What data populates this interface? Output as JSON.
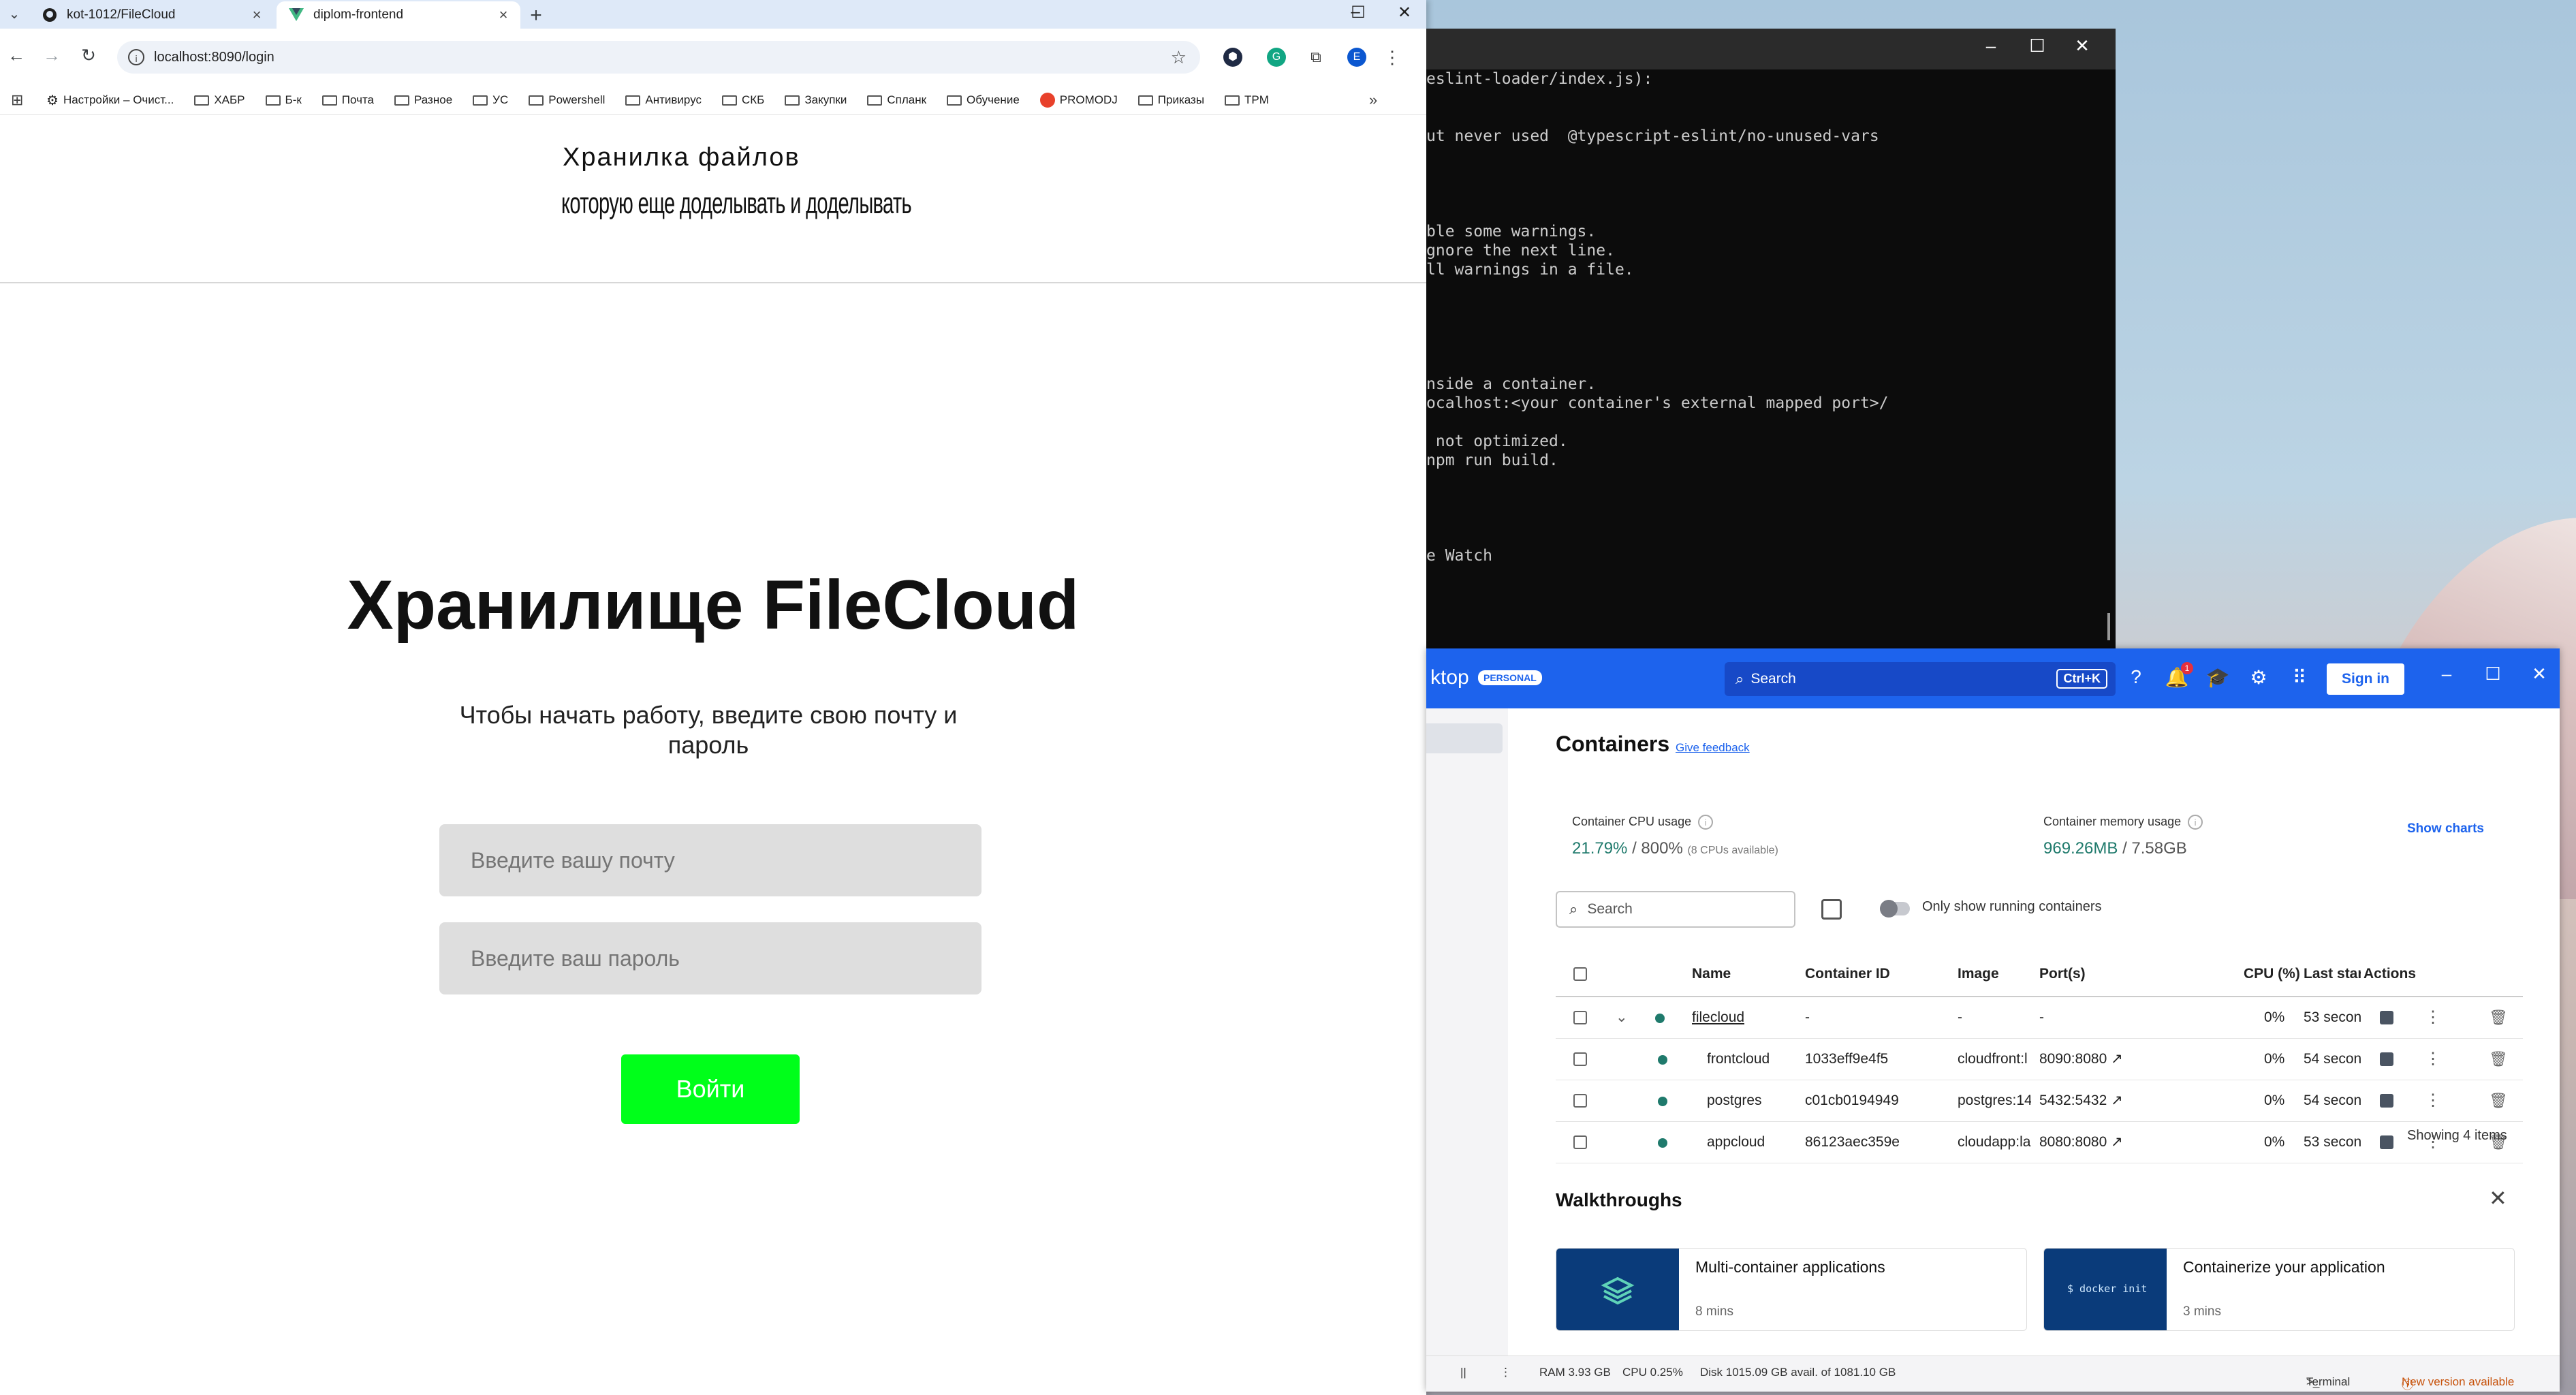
{
  "browser": {
    "tabs": [
      {
        "title": "kot-1012/FileCloud",
        "active": false,
        "icon": "github-icon"
      },
      {
        "title": "diplom-frontend",
        "active": true,
        "icon": "vue-icon"
      }
    ],
    "url": "localhost:8090/login",
    "bookmarks": [
      {
        "label": "Настройки – Очист...",
        "icon": "gear-icon"
      },
      {
        "label": "ХАБР",
        "icon": "folder-icon"
      },
      {
        "label": "Б-к",
        "icon": "folder-icon"
      },
      {
        "label": "Почта",
        "icon": "folder-icon"
      },
      {
        "label": "Разное",
        "icon": "folder-icon"
      },
      {
        "label": "УС",
        "icon": "folder-icon"
      },
      {
        "label": "Powershell",
        "icon": "folder-icon"
      },
      {
        "label": "Антивирус",
        "icon": "folder-icon"
      },
      {
        "label": "СКБ",
        "icon": "folder-icon"
      },
      {
        "label": "Закупки",
        "icon": "folder-icon"
      },
      {
        "label": "Спланк",
        "icon": "folder-icon"
      },
      {
        "label": "Обучение",
        "icon": "folder-icon"
      },
      {
        "label": "PROMODJ",
        "icon": "promodj-icon"
      },
      {
        "label": "Приказы",
        "icon": "folder-icon"
      },
      {
        "label": "TPM",
        "icon": "folder-icon"
      }
    ],
    "profile_initial": "E"
  },
  "site": {
    "header_title": "Хранилка файлов",
    "header_subtitle": "которую еще доделывать и доделывать",
    "login_title": "Хранилище FileCloud",
    "login_subtitle": "Чтобы начать работу, введите свою почту и пароль",
    "email_placeholder": "Введите вашу почту",
    "password_placeholder": "Введите ваш пароль",
    "login_button": "Войти"
  },
  "terminal": {
    "lines": [
      "eslint-loader/index.js):",
      "",
      "",
      "ut never used  @typescript-eslint/no-unused-vars",
      "",
      "",
      "",
      "",
      "ble some warnings.",
      "gnore the next line.",
      "ll warnings in a file.",
      "",
      "",
      "",
      "",
      "",
      "nside a container.",
      "ocalhost:<your container's external mapped port>/",
      "",
      " not optimized.",
      "npm run build.",
      "",
      "",
      "",
      "",
      "e Watch"
    ]
  },
  "docker": {
    "brand": "ktop",
    "badge": "PERSONAL",
    "search_label": "Search",
    "search_shortcut": "Ctrl+K",
    "notif_count": "1",
    "sign_in": "Sign in",
    "containers_title": "Containers",
    "give_feedback": "Give feedback",
    "cpu_label": "Container CPU usage",
    "cpu_value": "21.79%",
    "cpu_total": " / 800%",
    "cpu_note": "(8 CPUs available)",
    "mem_label": "Container memory usage",
    "mem_value": "969.26MB",
    "mem_total": " / 7.58GB",
    "show_charts": "Show charts",
    "search_placeholder": "Search",
    "only_running": "Only show running containers",
    "columns": [
      "Name",
      "Container ID",
      "Image",
      "Port(s)",
      "CPU (%)",
      "Last star",
      "Actions"
    ],
    "rows": [
      {
        "name": "filecloud",
        "id": "-",
        "image": "-",
        "ports": "-",
        "cpu": "0%",
        "last": "53 secon",
        "group": true
      },
      {
        "name": "frontcloud",
        "id": "1033eff9e4f5",
        "image": "cloudfront:l",
        "ports": "8090:8080",
        "cpu": "0%",
        "last": "54 secon",
        "group": false
      },
      {
        "name": "postgres",
        "id": "c01cb0194949",
        "image": "postgres:14",
        "ports": "5432:5432",
        "cpu": "0%",
        "last": "54 secon",
        "group": false
      },
      {
        "name": "appcloud",
        "id": "86123aec359e",
        "image": "cloudapp:la",
        "ports": "8080:8080",
        "cpu": "0%",
        "last": "53 secon",
        "group": false
      }
    ],
    "showing": "Showing 4 items",
    "walkthroughs_title": "Walkthroughs",
    "cards": [
      {
        "title": "Multi-container applications",
        "meta": "8 mins"
      },
      {
        "title": "Containerize your application",
        "meta": "3 mins",
        "thumb_text": "$ docker init"
      }
    ],
    "status": {
      "ram": "RAM 3.93 GB",
      "cpu": "CPU 0.25%",
      "disk": "Disk 1015.09 GB avail. of 1081.10 GB",
      "terminal": "Terminal",
      "new_version": "New version available"
    }
  }
}
